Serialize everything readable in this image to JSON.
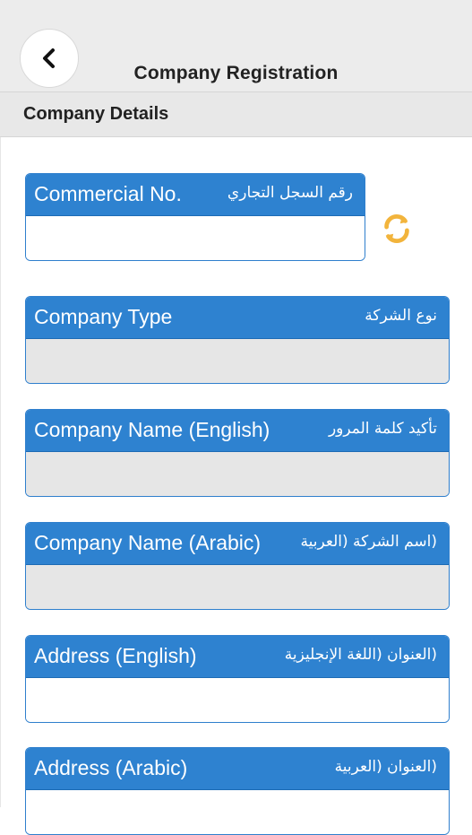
{
  "header": {
    "title": "Company Registration",
    "back_icon": "chevron-left-icon"
  },
  "section": {
    "title": "Company Details"
  },
  "fields": [
    {
      "label_en": "Commercial No.",
      "label_ar": "رقم السجل التجاري",
      "value": "",
      "state": "enabled",
      "action_icon": "refresh-icon"
    },
    {
      "label_en": "Company Type",
      "label_ar": "نوع الشركة",
      "value": "",
      "state": "disabled"
    },
    {
      "label_en": "Company Name (English)",
      "label_ar": "تأكيد كلمة المرور",
      "value": "",
      "state": "disabled"
    },
    {
      "label_en": "Company Name (Arabic)",
      "label_ar": "(اسم الشركة (العربية",
      "value": "",
      "state": "disabled"
    },
    {
      "label_en": "Address (English)",
      "label_ar": "(العنوان (اللغة الإنجليزية",
      "value": "",
      "state": "enabled"
    },
    {
      "label_en": "Address (Arabic)",
      "label_ar": "(العنوان (العربية",
      "value": "",
      "state": "enabled"
    }
  ],
  "colors": {
    "accent": "#2e82d0",
    "header_bg": "#ececec",
    "disabled_input": "#e6e6e6",
    "refresh_icon": "#f2b43c"
  }
}
